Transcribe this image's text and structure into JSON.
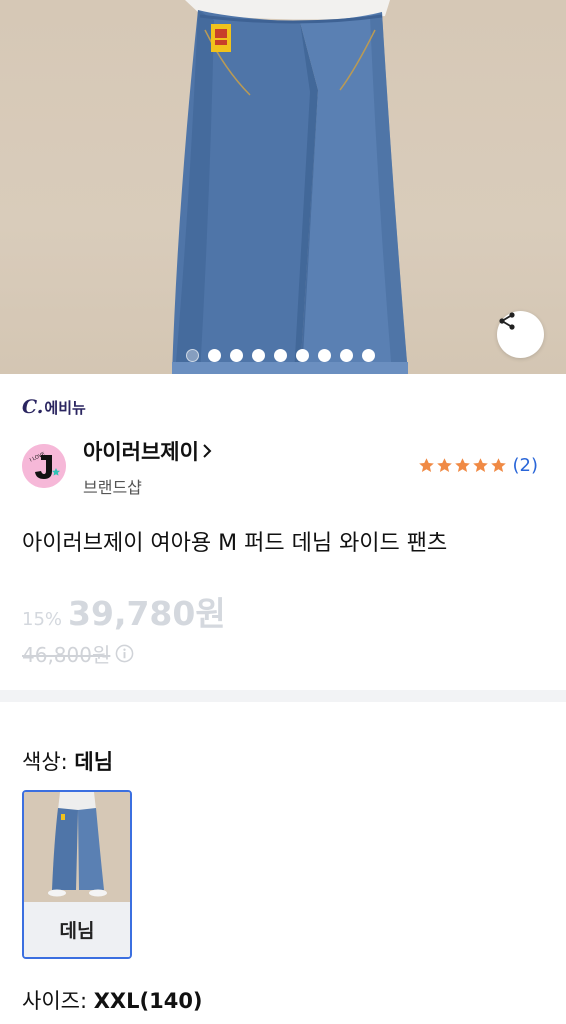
{
  "hero": {
    "image_alt": "denim wide pants product photo",
    "carousel": {
      "total": 9,
      "active_index": 0
    }
  },
  "store": {
    "prefix": "C.",
    "name": "에비뉴"
  },
  "brand": {
    "name": "아이러브제이",
    "subtitle": "브랜드샵",
    "rating_stars": 5,
    "review_count": "(2)"
  },
  "product": {
    "title": "아이러브제이 여아용 M 퍼드 데님 와이드 팬츠",
    "discount": "15%",
    "price": "39,780원",
    "original_price": "46,800원"
  },
  "options": {
    "color_label": "색상:",
    "color_value": "데님",
    "swatch_label": "데님",
    "size_label": "사이즈:",
    "size_value": "XXL(140)"
  },
  "colors": {
    "accent_blue": "#3b6fe0",
    "review_blue": "#2a66d8",
    "star_orange": "#f08a45",
    "store_navy": "#2a2560",
    "price_muted": "#d4d8de"
  },
  "icons": [
    "share-icon",
    "chevron-right-icon",
    "star-icon",
    "info-icon"
  ]
}
